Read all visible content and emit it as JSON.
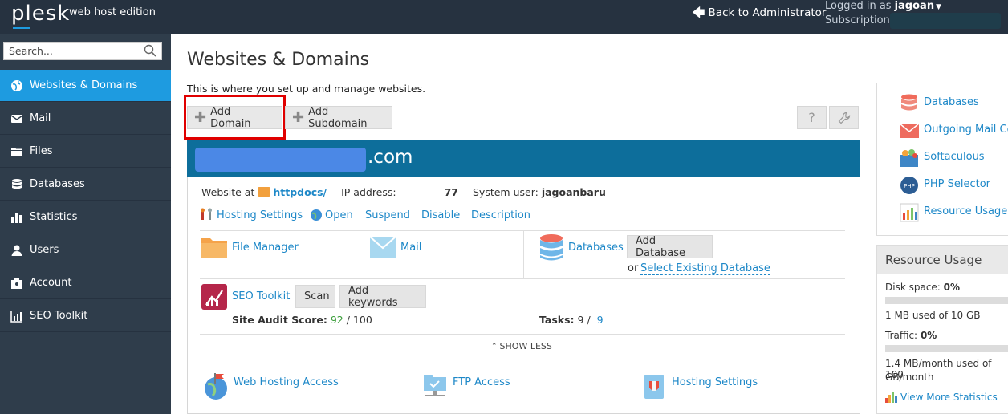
{
  "topbar": {
    "logo": "plesk",
    "edition": "web host edition",
    "back_label": "Back to Administrator",
    "logged_in_label": "Logged in as",
    "username": "jagoan",
    "subscription_label": "Subscription"
  },
  "sidebar": {
    "search_placeholder": "Search...",
    "items": [
      {
        "label": "Websites & Domains",
        "icon": "globe-icon",
        "active": true
      },
      {
        "label": "Mail",
        "icon": "envelope-icon"
      },
      {
        "label": "Files",
        "icon": "files-icon"
      },
      {
        "label": "Databases",
        "icon": "database-icon"
      },
      {
        "label": "Statistics",
        "icon": "bar-chart-icon"
      },
      {
        "label": "Users",
        "icon": "user-icon"
      },
      {
        "label": "Account",
        "icon": "account-icon"
      },
      {
        "label": "SEO Toolkit",
        "icon": "seo-chart-icon"
      }
    ]
  },
  "main": {
    "title": "Websites & Domains",
    "description": "This is where you set up and manage websites.",
    "add_domain": "Add Domain",
    "add_subdomain": "Add Subdomain",
    "help_icon": "?",
    "colors": {
      "accent": "#1e9be0",
      "header": "#0d6e9b",
      "highlight": "#e00000"
    }
  },
  "domain": {
    "tld": ".com",
    "website_at_label": "Website at",
    "httpdocs": "httpdocs/",
    "ip_label": "IP address:",
    "ip_suffix": "77",
    "system_user_label": "System user:",
    "system_user": "jagoanbaru",
    "actions": [
      "Hosting Settings",
      "Open",
      "Suspend",
      "Disable",
      "Description"
    ],
    "file_manager": "File Manager",
    "mail": "Mail",
    "databases": "Databases",
    "add_database": "Add Database",
    "or_label": "or",
    "select_existing": "Select Existing Database",
    "seo_toolkit": "SEO Toolkit",
    "scan": "Scan",
    "add_keywords": "Add keywords",
    "audit_label": "Site Audit Score:",
    "audit_score": "92",
    "audit_max": "/ 100",
    "tasks_label": "Tasks:",
    "tasks_done": "9 /",
    "tasks_total": "9",
    "show_less": "SHOW LESS",
    "web_hosting_access": "Web Hosting Access",
    "ftp_access": "FTP Access",
    "hosting_settings": "Hosting Settings"
  },
  "quick_links": [
    {
      "label": "Databases",
      "icon": "database-color-icon"
    },
    {
      "label": "Outgoing Mail Co",
      "icon": "outgoing-mail-icon"
    },
    {
      "label": "Softaculous",
      "icon": "softaculous-icon"
    },
    {
      "label": "PHP Selector",
      "icon": "php-icon"
    },
    {
      "label": "Resource Usage",
      "icon": "resource-usage-icon"
    }
  ],
  "resource_usage": {
    "title": "Resource Usage",
    "disk_label": "Disk space:",
    "disk_pct": "0%",
    "disk_detail": "1 MB used of 10 GB",
    "traffic_label": "Traffic:",
    "traffic_pct": "0%",
    "traffic_detail_1": "1.4 MB/month used of 100",
    "traffic_detail_2": "GB/month",
    "view_more": "View More Statistics"
  }
}
